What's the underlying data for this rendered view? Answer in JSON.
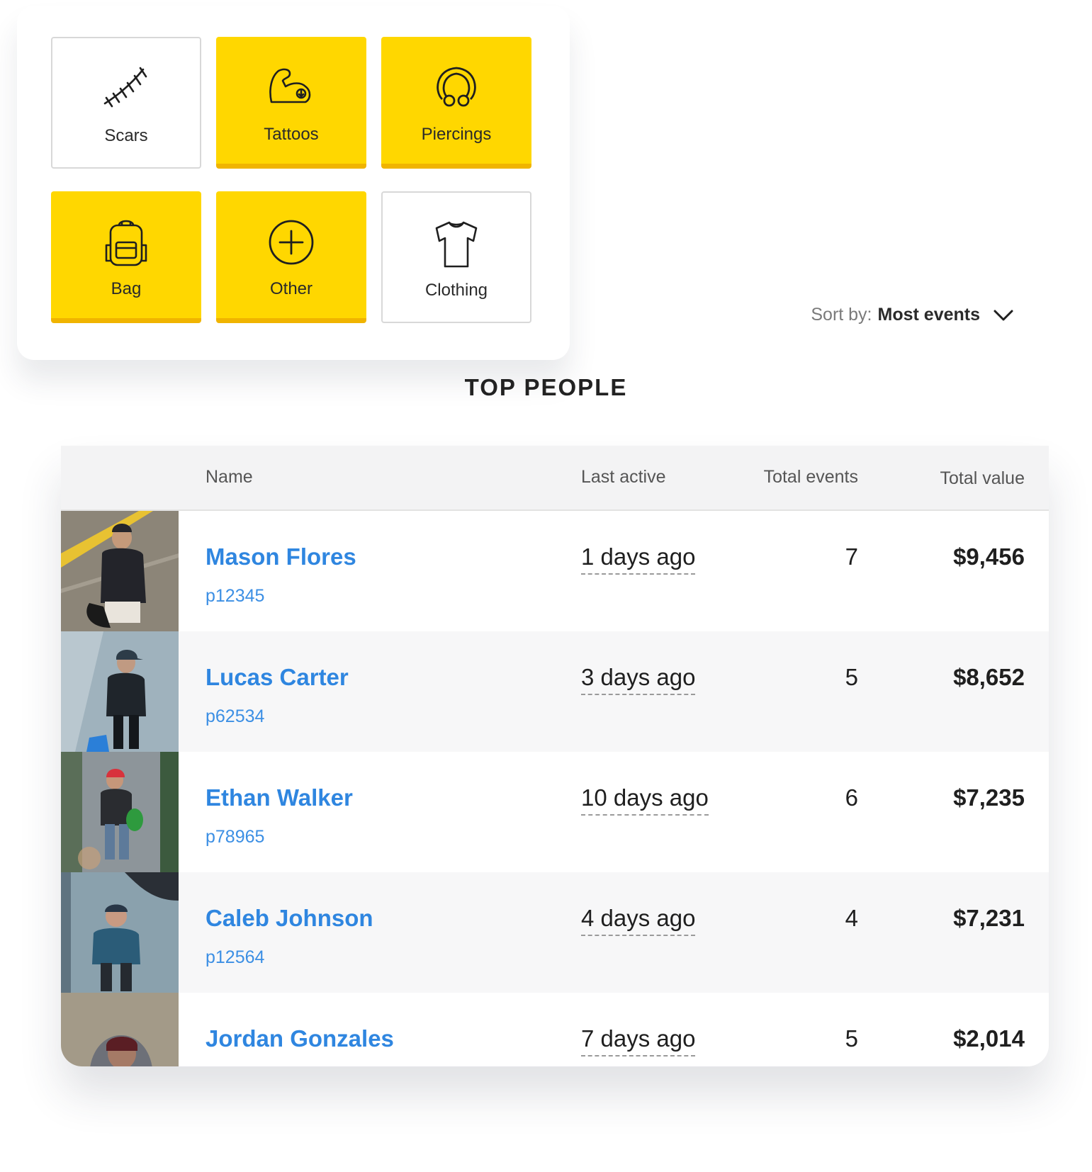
{
  "filters": [
    {
      "label": "Scars",
      "icon": "scar-icon",
      "active": false
    },
    {
      "label": "Tattoos",
      "icon": "tattoo-arm-icon",
      "active": true
    },
    {
      "label": "Piercings",
      "icon": "piercing-ring-icon",
      "active": true
    },
    {
      "label": "Bag",
      "icon": "backpack-icon",
      "active": true
    },
    {
      "label": "Other",
      "icon": "plus-circle-icon",
      "active": true
    },
    {
      "label": "Clothing",
      "icon": "tshirt-icon",
      "active": false
    }
  ],
  "sort": {
    "label": "Sort by:",
    "value": "Most events"
  },
  "section_title": "TOP PEOPLE",
  "table": {
    "headers": {
      "name": "Name",
      "last_active": "Last active",
      "total_events": "Total events",
      "total_value": "Total value"
    },
    "rows": [
      {
        "name": "Mason Flores",
        "id": "p12345",
        "last_active": "1 days ago",
        "events": "7",
        "value": "$9,456"
      },
      {
        "name": "Lucas Carter",
        "id": "p62534",
        "last_active": "3 days ago",
        "events": "5",
        "value": "$8,652"
      },
      {
        "name": "Ethan Walker",
        "id": "p78965",
        "last_active": "10 days ago",
        "events": "6",
        "value": "$7,235"
      },
      {
        "name": "Caleb Johnson",
        "id": "p12564",
        "last_active": "4 days ago",
        "events": "4",
        "value": "$7,231"
      },
      {
        "name": "Jordan Gonzales",
        "id": "",
        "last_active": "7 days ago",
        "events": "5",
        "value": "$2,014"
      }
    ]
  },
  "colors": {
    "accent_yellow": "#ffd700",
    "link_blue": "#2f86e0"
  }
}
